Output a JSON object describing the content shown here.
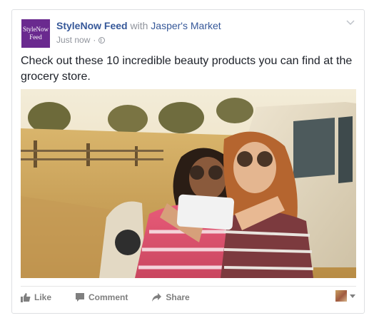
{
  "post": {
    "avatar_text_line1": "StyleNow",
    "avatar_text_line2": "Feed",
    "page_name": "StyleNow Feed",
    "with_word": "with",
    "tagged_page": "Jasper's Market",
    "timestamp": "Just now",
    "separator": "·",
    "privacy_icon": "globe-icon",
    "menu_icon": "chevron-down-icon",
    "text": "Check out these 10 incredible beauty products you can find at the grocery store."
  },
  "actions": {
    "like_label": "Like",
    "like_icon": "thumbs-up-icon",
    "comment_label": "Comment",
    "comment_icon": "comment-icon",
    "share_label": "Share",
    "share_icon": "share-arrow-icon"
  },
  "colors": {
    "link": "#365899",
    "avatar_bg": "#6a2a8f",
    "meta": "#90949c",
    "action_text": "#7f7f7f"
  }
}
